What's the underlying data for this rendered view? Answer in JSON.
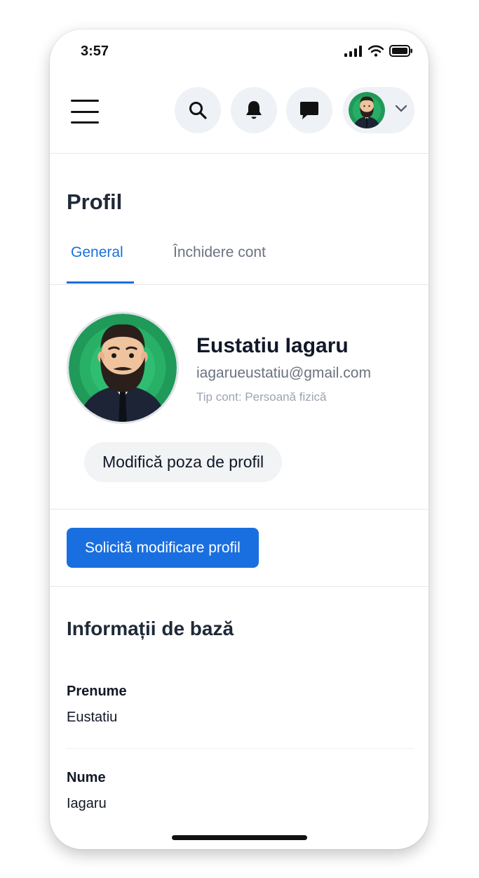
{
  "status_bar": {
    "time": "3:57"
  },
  "header": {
    "menu_icon": "hamburger-menu-icon",
    "search_icon": "search-icon",
    "notifications_icon": "bell-icon",
    "messages_icon": "chat-bubble-icon",
    "account_icon": "chevron-down-icon"
  },
  "page": {
    "title": "Profil",
    "tabs": [
      {
        "label": "General",
        "active": true
      },
      {
        "label": "Închidere cont",
        "active": false
      }
    ]
  },
  "profile": {
    "name": "Eustatiu Iagaru",
    "email": "iagarueustatiu@gmail.com",
    "account_type": "Tip cont: Persoană fizică",
    "change_photo_label": "Modifică poza de profil"
  },
  "actions": {
    "request_change_label": "Solicită modificare profil"
  },
  "basic_info": {
    "title": "Informații de bază",
    "fields": [
      {
        "label": "Prenume",
        "value": "Eustatiu"
      },
      {
        "label": "Nume",
        "value": "Iagaru"
      }
    ]
  },
  "colors": {
    "accent": "#1a6fe0",
    "avatar_bg": "#1f9a58",
    "chip_bg": "#eef1f5"
  }
}
